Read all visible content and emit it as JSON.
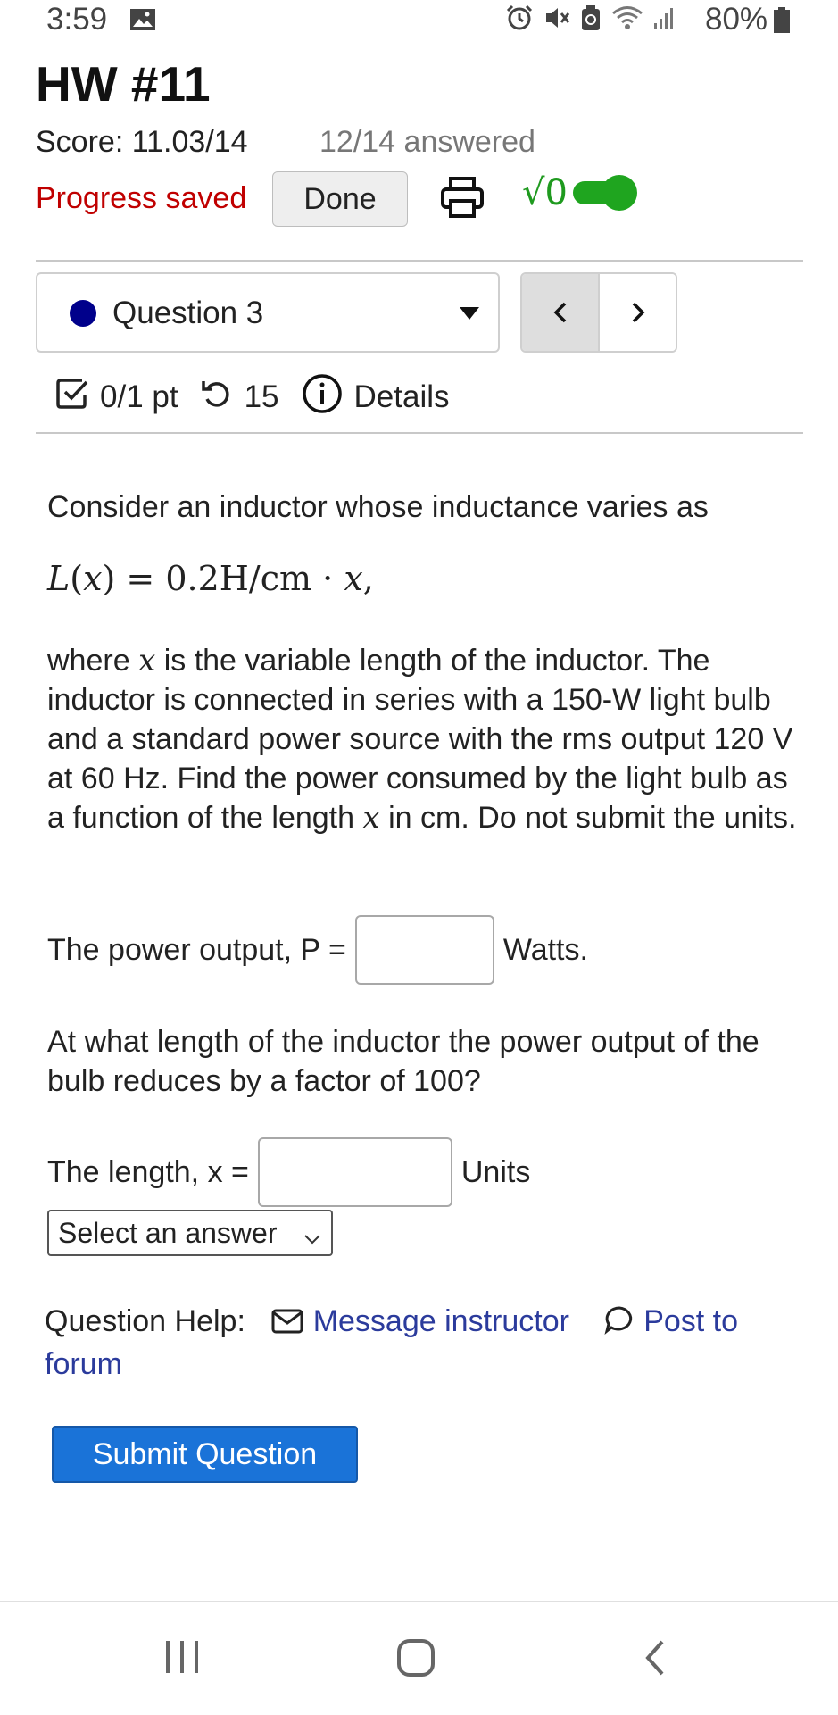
{
  "status_bar": {
    "time": "3:59",
    "battery": "80%",
    "icons": [
      "gallery-icon",
      "alarm-icon",
      "mute-icon",
      "recycle-icon",
      "wifi-icon",
      "signal-icon",
      "battery-icon"
    ]
  },
  "header": {
    "title": "HW #11",
    "score": "Score: 11.03/14",
    "answered": "12/14 answered",
    "progress": "Progress saved",
    "done_label": "Done",
    "math_toggle": "√0",
    "colors": {
      "progress": "#c00000",
      "toggle": "#1fa51f"
    }
  },
  "question_nav": {
    "current": "Question 3",
    "status_color": "#00008b",
    "prev": "<",
    "next": ">"
  },
  "details": {
    "points": "0/1 pt",
    "attempts": "15",
    "details_label": "Details"
  },
  "question": {
    "intro": "Consider an inductor whose inductance varies as",
    "formula": {
      "lhs_fn": "L",
      "lhs_var": "x",
      "equals": "=",
      "rhs_value": "0.2H/cm",
      "dot": "·",
      "rhs_var": "x",
      "tail": ","
    },
    "para_1": "where ",
    "para_var": "x",
    "para_2": " is the variable length of the inductor. The inductor is connected in series with a 150-W light bulb and a standard power source with the rms output 120 V at 60 Hz. Find the power consumed by the light bulb as a function of the length ",
    "para_var2": "x",
    "para_3": " in cm. Do not submit the units.",
    "power_label": "The power output, P =",
    "power_value": "",
    "power_unit": "Watts.",
    "question2": "At what length of the inductor the power output of the bulb reduces by a factor of 100?",
    "length_label": "The length, x =",
    "length_value": "",
    "length_unit": "Units",
    "unit_select": "Select an answer"
  },
  "help": {
    "label": "Question Help:",
    "message": "Message instructor",
    "forum": "Post to forum"
  },
  "submit_label": "Submit Question"
}
